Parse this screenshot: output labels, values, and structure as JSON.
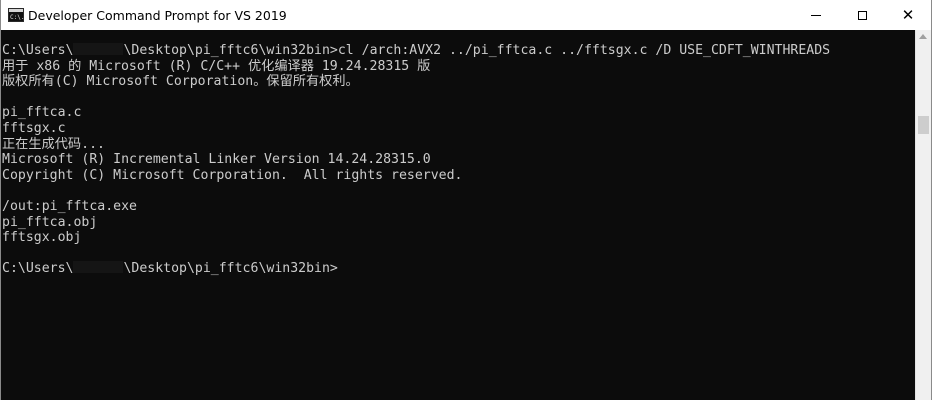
{
  "window": {
    "title": "Developer Command Prompt for VS 2019",
    "icon": "console-icon",
    "icon_glyph": "C:\\."
  },
  "controls": {
    "minimize": "minimize-icon",
    "maximize": "maximize-icon",
    "close_symbol": "✕"
  },
  "console": {
    "background": "#0c0c0c",
    "foreground": "#cccccc",
    "lines": [
      {
        "segments": [
          "C:\\Users\\",
          "",
          "\\Desktop\\pi_fftc6\\win32bin>cl /arch:AVX2 ../pi_fftca.c ../fftsgx.c /D USE_CDFT_WINTHREADS"
        ]
      },
      {
        "segments": [
          "用于 x86 的 Microsoft (R) C/C++ 优化编译器 19.24.28315 版"
        ]
      },
      {
        "segments": [
          "版权所有(C) Microsoft Corporation。保留所有权利。"
        ]
      },
      {
        "segments": [
          ""
        ]
      },
      {
        "segments": [
          "pi_fftca.c"
        ]
      },
      {
        "segments": [
          "fftsgx.c"
        ]
      },
      {
        "segments": [
          "正在生成代码..."
        ]
      },
      {
        "segments": [
          "Microsoft (R) Incremental Linker Version 14.24.28315.0"
        ]
      },
      {
        "segments": [
          "Copyright (C) Microsoft Corporation.  All rights reserved."
        ]
      },
      {
        "segments": [
          ""
        ]
      },
      {
        "segments": [
          "/out:pi_fftca.exe"
        ]
      },
      {
        "segments": [
          "pi_fftca.obj"
        ]
      },
      {
        "segments": [
          "fftsgx.obj"
        ]
      },
      {
        "segments": [
          ""
        ]
      },
      {
        "segments": [
          "C:\\Users\\",
          "",
          "\\Desktop\\pi_fftc6\\win32bin>"
        ]
      }
    ]
  }
}
